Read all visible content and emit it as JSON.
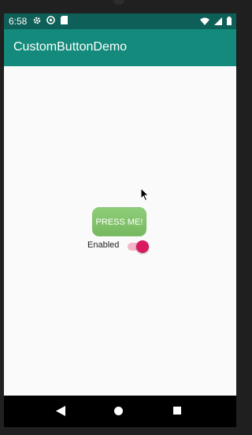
{
  "status_bar": {
    "time": "6:58",
    "left_icons": [
      "gear-icon",
      "sync-icon",
      "sd-card-icon"
    ],
    "right_icons": [
      "wifi-icon",
      "signal-icon",
      "battery-icon"
    ]
  },
  "app_bar": {
    "title": "CustomButtonDemo"
  },
  "main": {
    "custom_button_label": "PRESS ME!",
    "switch_label": "Enabled",
    "switch_checked": true
  },
  "colors": {
    "status_bar": "#0d5f57",
    "app_bar": "#138a7b",
    "button_green": "#80c06a",
    "switch_accent": "#d81b60"
  },
  "nav_bar": {
    "icons": [
      "back-icon",
      "home-icon",
      "recents-icon"
    ]
  }
}
